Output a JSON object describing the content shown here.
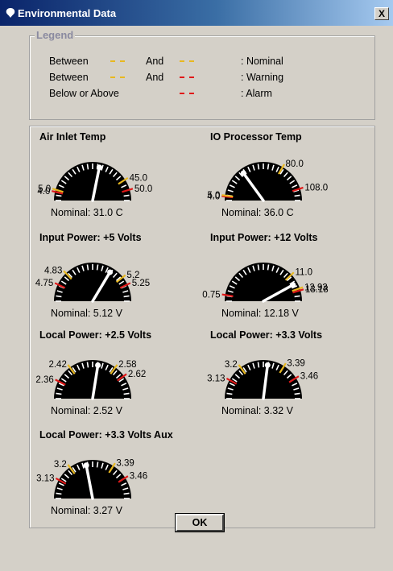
{
  "window": {
    "title": "Environmental Data",
    "close_label": "X"
  },
  "legend": {
    "title": "Legend",
    "rows": [
      {
        "condition": "Between",
        "conjunction": "And",
        "result": ": Nominal",
        "color1": "#e8b820",
        "color2": "#e8b820"
      },
      {
        "condition": "Between",
        "conjunction": "And",
        "result": ": Warning",
        "color1": "#e8b820",
        "color2": "#e01818"
      },
      {
        "condition": "Below or Above",
        "conjunction": "",
        "result": ": Alarm",
        "color1": "#e01818",
        "color2": ""
      }
    ]
  },
  "colors": {
    "nominal": "#e8b820",
    "alarm": "#e01818",
    "dial": "#000000",
    "needle": "#ffffff"
  },
  "gauges": [
    {
      "title": "Air Inlet Temp",
      "nominal": "Nominal: 31.0 C",
      "labels": [
        "4.0",
        "5.0",
        "45.0",
        "50.0"
      ],
      "min": 0,
      "max": 55,
      "value": 31.0
    },
    {
      "title": "IO Processor Temp",
      "nominal": "Nominal: 36.0 C",
      "labels": [
        "4.0",
        "5.0",
        "80.0",
        "108.0"
      ],
      "min": 0,
      "max": 120,
      "value": 36.0
    },
    {
      "title": "Input Power: +5 Volts",
      "nominal": "Nominal: 5.12 V",
      "labels": [
        "4.75",
        "4.83",
        "5.2",
        "5.25"
      ],
      "min": 4.65,
      "max": 5.35,
      "value": 5.12
    },
    {
      "title": "Input Power: +12 Volts",
      "nominal": "Nominal: 12.18 V",
      "labels": [
        "0.75",
        "11.0",
        "12.93",
        "13.18"
      ],
      "min": 0,
      "max": 14.5,
      "value": 12.18
    },
    {
      "title": "Local Power: +2.5 Volts",
      "nominal": "Nominal: 2.52 V",
      "labels": [
        "2.36",
        "2.42",
        "2.58",
        "2.62"
      ],
      "min": 2.3,
      "max": 2.7,
      "value": 2.52
    },
    {
      "title": "Local Power: +3.3 Volts",
      "nominal": "Nominal: 3.32 V",
      "labels": [
        "3.13",
        "3.2",
        "3.39",
        "3.46"
      ],
      "min": 3.05,
      "max": 3.55,
      "value": 3.32
    },
    {
      "title": "Local Power: +3.3 Volts Aux",
      "nominal": "Nominal: 3.27 V",
      "labels": [
        "3.13",
        "3.2",
        "3.39",
        "3.46"
      ],
      "min": 3.05,
      "max": 3.55,
      "value": 3.27
    }
  ],
  "ok_label": "OK"
}
